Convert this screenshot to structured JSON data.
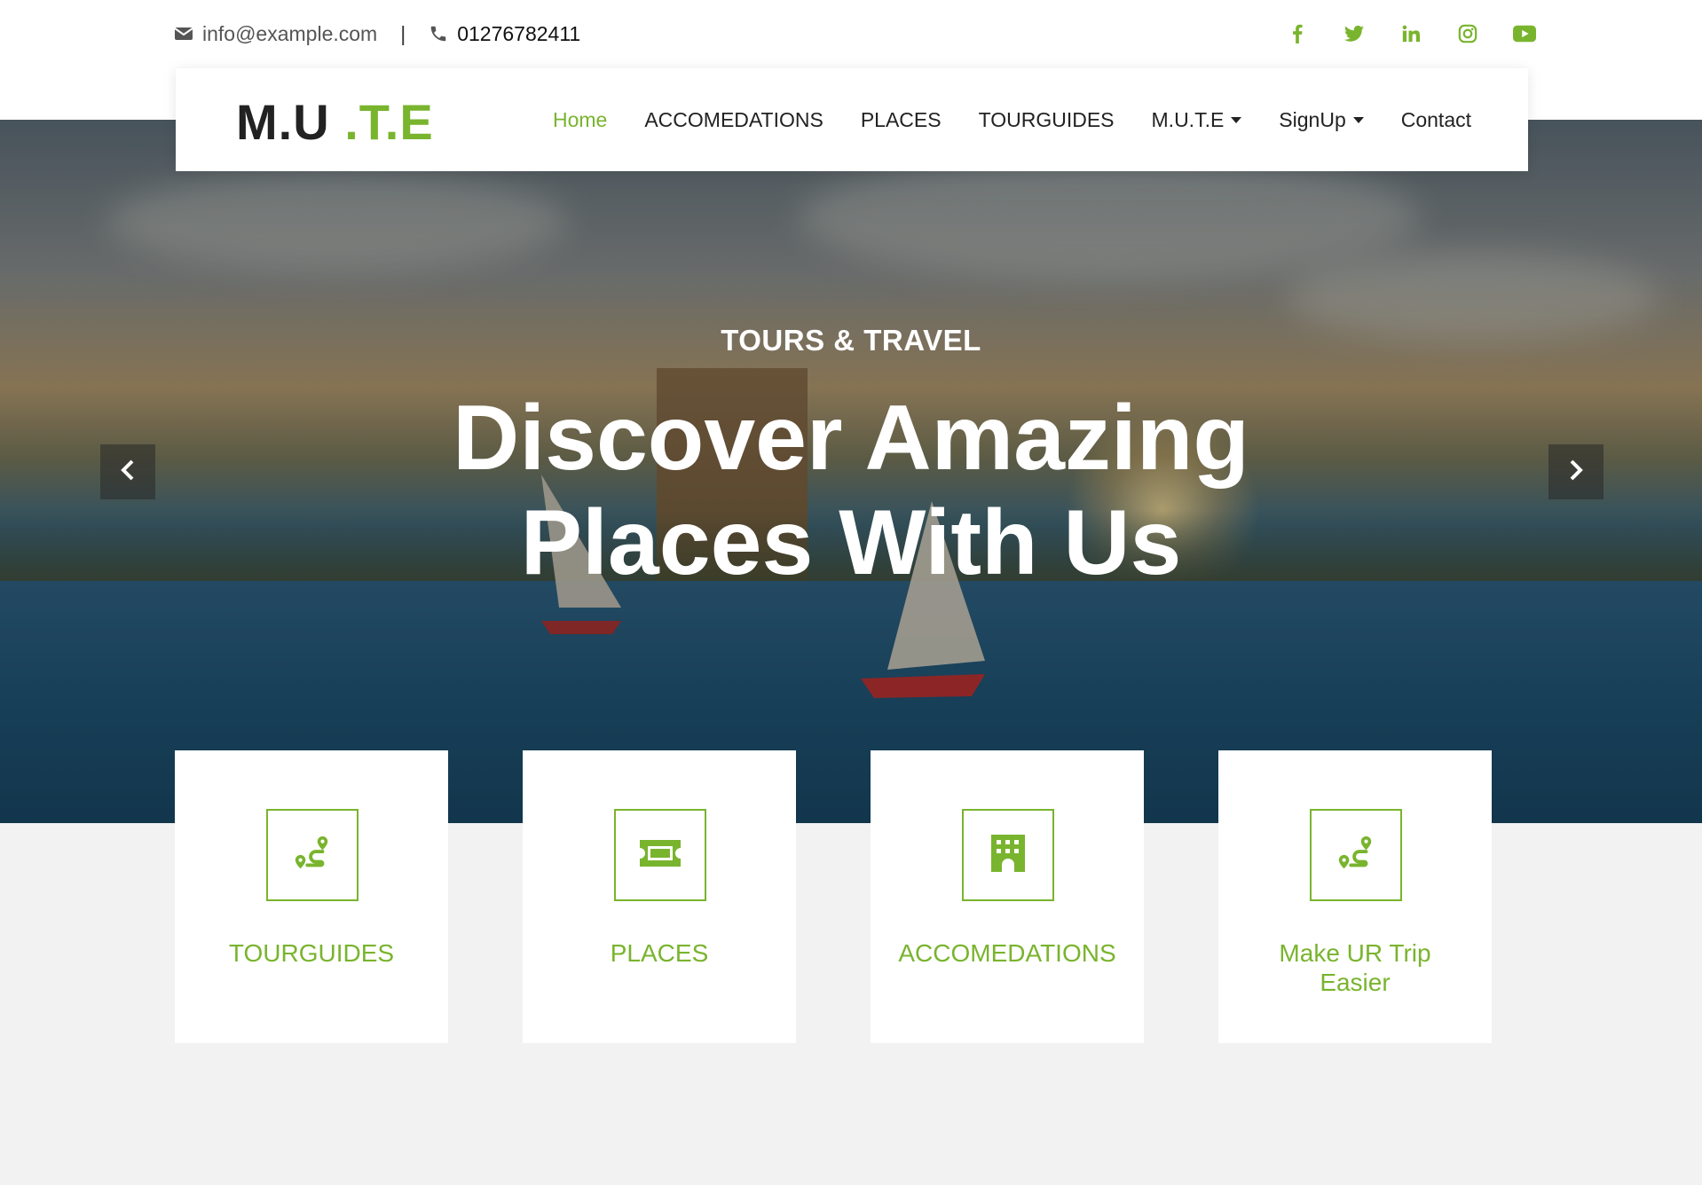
{
  "topbar": {
    "email": "info@example.com",
    "separator": "|",
    "phone": "01276782411",
    "social": [
      "facebook-icon",
      "twitter-icon",
      "linkedin-icon",
      "instagram-icon",
      "youtube-icon"
    ]
  },
  "brand": {
    "logo_part1": "M.U",
    "logo_part2": " .T.E",
    "accent_color": "#79b42e"
  },
  "nav": {
    "items": [
      {
        "label": "Home",
        "active": true
      },
      {
        "label": "ACCOMEDATIONS"
      },
      {
        "label": "PLACES"
      },
      {
        "label": "TOURGUIDES"
      },
      {
        "label": "M.U.T.E",
        "dropdown": true
      },
      {
        "label": "SignUp",
        "dropdown": true
      },
      {
        "label": "Contact"
      }
    ]
  },
  "hero": {
    "eyebrow": "TOURS & TRAVEL",
    "headline_line1": "Discover Amazing",
    "headline_line2": "Places With Us"
  },
  "features": [
    {
      "label": "TOURGUIDES",
      "icon": "route-icon"
    },
    {
      "label": "PLACES",
      "icon": "ticket-icon"
    },
    {
      "label": "ACCOMEDATIONS",
      "icon": "hotel-icon"
    },
    {
      "label": "Make UR Trip Easier",
      "icon": "route-icon"
    }
  ]
}
